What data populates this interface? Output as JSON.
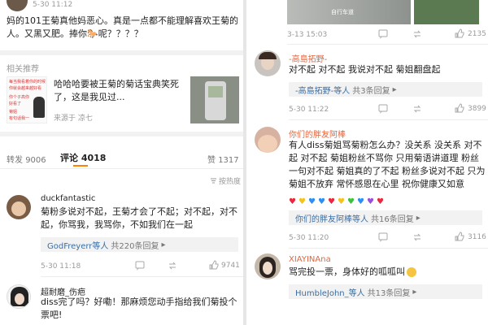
{
  "left": {
    "top_post": {
      "time": "5-30 11:12",
      "text": "妈的101王菊真他妈恶心。真是一点都不能理解喜欢王菊的人。又黑又肥。捧你🐎呢？？？？"
    },
    "related": {
      "header": "相关推荐",
      "thumb_lines": [
        "每当我看着你的时候",
        "你就会越来越好看",
        "你个子高你",
        "好看了",
        "菊姐",
        "有句话我一"
      ],
      "title": "哈哈哈要被王菊的菊话宝典笑死了，这是我见过...",
      "source_label": "来源于",
      "source": "凉七"
    },
    "tabs": [
      {
        "label": "转发",
        "count": "9006"
      },
      {
        "label": "评论",
        "count": "4018"
      },
      {
        "label": "赞",
        "count": "1317"
      }
    ],
    "sort_label": "按热度",
    "comments": [
      {
        "user": "duckfantastic",
        "text": "菊粉多说对不起，王菊才会了不起；对不起，对不起，你骂我，我骂你，不如我们在一起",
        "reply_user": "GodFreyerr等人",
        "reply_count": "共220条回复",
        "time": "5-30 11:18",
        "likes": "9741"
      },
      {
        "user": "超耐磨_伤疤",
        "text": "diss完了吗？好嘞！那麻烦您动手指给我们菊投个票吧!"
      }
    ]
  },
  "right": {
    "top_image_label": "自行车道",
    "top_meta": {
      "time": "3-13 15:03",
      "likes": "2135"
    },
    "comments": [
      {
        "user": "-高島拓野-",
        "text": "对不起 对不起 我说对不起 菊姐翻盘起",
        "reply_user": "-高島拓野-等人",
        "reply_count": "共3条回复",
        "time": "5-30 11:22",
        "likes": "3899"
      },
      {
        "user": "你们的胖友阿棒",
        "text": "有人diss菊姐骂菊粉怎么办？没关系 没关系 对不起 对不起 菊姐粉丝不骂你 只用菊语讲道理 粉丝一句对不起 菊姐真的了不起 粉丝多说对不起 只为菊姐不放弃 常怀感恩在心里 祝你健康又如意",
        "hearts": [
          "#e8283c",
          "#f3c21c",
          "#2f8ef0",
          "#2f8ef0",
          "#e8283c",
          "#f3c21c",
          "#3fbf3f",
          "#2f8ef0",
          "#9b4fd8",
          "#e8283c"
        ],
        "reply_user": "你们的胖友阿棒等人",
        "reply_count": "共16条回复",
        "time": "5-30 11:20",
        "likes": "3116"
      },
      {
        "user": "XIAYINAna",
        "text": "骂完投一票，身体好的呱呱叫",
        "reply_user": "HumbleJohn_等人",
        "reply_count": "共13条回复"
      }
    ]
  }
}
